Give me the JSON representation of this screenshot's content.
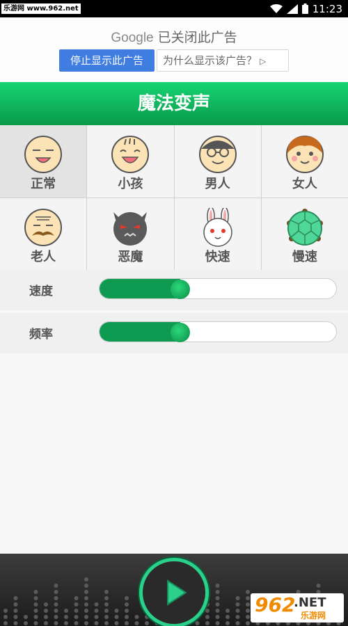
{
  "status_bar": {
    "watermark": "乐游网 www.962.net",
    "time": "11:23"
  },
  "ad": {
    "brand": "Google",
    "closed_text": "已关闭此广告",
    "stop_label": "停止显示此广告",
    "why_label": "为什么显示该广告？",
    "why_icon": "play-triangle-icon"
  },
  "title": "魔法变声",
  "voices": [
    {
      "label": "正常",
      "icon": "normal-face-icon",
      "selected": true
    },
    {
      "label": "小孩",
      "icon": "child-face-icon",
      "selected": false
    },
    {
      "label": "男人",
      "icon": "man-face-icon",
      "selected": false
    },
    {
      "label": "女人",
      "icon": "woman-face-icon",
      "selected": false
    },
    {
      "label": "老人",
      "icon": "old-man-face-icon",
      "selected": false
    },
    {
      "label": "恶魔",
      "icon": "devil-face-icon",
      "selected": false
    },
    {
      "label": "快速",
      "icon": "rabbit-icon",
      "selected": false
    },
    {
      "label": "慢速",
      "icon": "turtle-icon",
      "selected": false
    }
  ],
  "sliders": [
    {
      "label": "速度",
      "level": 0.34
    },
    {
      "label": "频率",
      "level": 0.34
    }
  ],
  "footer": {
    "play_icon": "play-icon",
    "logo_text": "962",
    "logo_net": ".NET",
    "logo_cn": "乐游网"
  },
  "colors": {
    "accent": "#0f9a52",
    "title_top": "#16d472",
    "ad_button": "#3f7ee0",
    "logo": "#f08a00"
  }
}
